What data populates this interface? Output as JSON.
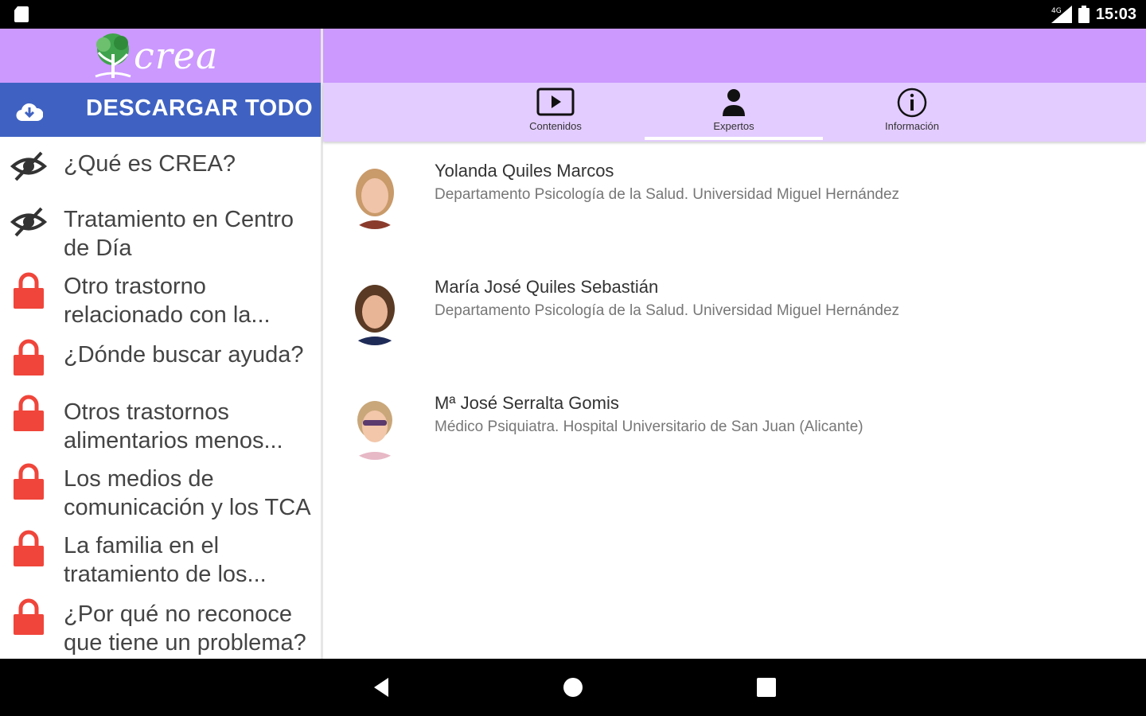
{
  "status_bar": {
    "time": "15:03"
  },
  "app": {
    "logo_text": "crea",
    "accent_color": "#cc99ff",
    "download_color": "#3f62c2",
    "lock_color": "#f0453a"
  },
  "sidebar": {
    "download_label": "DESCARGAR TODO",
    "items": [
      {
        "label": "¿Qué es CREA?",
        "icon": "eye-off-icon"
      },
      {
        "label": "Tratamiento en Centro de Día",
        "icon": "eye-off-icon"
      },
      {
        "label": "Otro trastorno relacionado con la...",
        "icon": "lock-icon"
      },
      {
        "label": "¿Dónde buscar ayuda?",
        "icon": "lock-icon"
      },
      {
        "label": "Otros trastornos alimentarios menos...",
        "icon": "lock-icon"
      },
      {
        "label": "Los medios de comunicación y los TCA",
        "icon": "lock-icon"
      },
      {
        "label": "La familia en el tratamiento de los...",
        "icon": "lock-icon"
      },
      {
        "label": "¿Por qué no reconoce que tiene un problema?",
        "icon": "lock-icon"
      }
    ]
  },
  "tabs": [
    {
      "label": "Contenidos",
      "icon": "play-icon"
    },
    {
      "label": "Expertos",
      "icon": "person-icon",
      "selected": true
    },
    {
      "label": "Información",
      "icon": "info-icon"
    }
  ],
  "experts": [
    {
      "name": "Yolanda Quiles Marcos",
      "dept": "Departamento Psicología de la Salud. Universidad Miguel Hernández"
    },
    {
      "name": "María José Quiles Sebastián",
      "dept": "Departamento Psicología de la Salud. Universidad Miguel Hernández"
    },
    {
      "name": "Mª José Serralta Gomis",
      "dept": "Médico Psiquiatra. Hospital Universitario de San Juan (Alicante)"
    }
  ]
}
